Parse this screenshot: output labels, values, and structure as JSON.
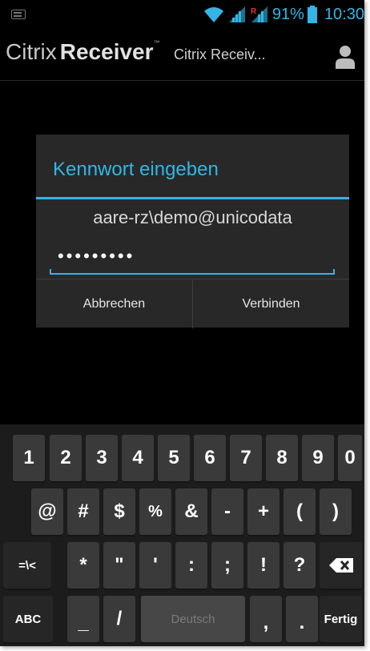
{
  "status_bar": {
    "battery": "91%",
    "clock": "10:30",
    "accent_color": "#33b5e5",
    "icons": [
      "keyboard-notification-icon",
      "wifi-icon",
      "signal-icon",
      "signal-roaming-icon",
      "battery-icon"
    ]
  },
  "action_bar": {
    "brand_citrix": "Citrix",
    "brand_receiver": "Receiver",
    "brand_tm": "™",
    "title": "Citrix Receiv...",
    "icons": [
      "user-icon"
    ]
  },
  "dialog": {
    "title": "Kennwort eingeben",
    "username": "aare-rz\\demo@unicodata",
    "password_masked": "•••••••••",
    "cancel_label": "Abbrechen",
    "connect_label": "Verbinden"
  },
  "keyboard": {
    "row1": [
      "1",
      "2",
      "3",
      "4",
      "5",
      "6",
      "7",
      "8",
      "9",
      "0"
    ],
    "row2": [
      "@",
      "#",
      "$",
      "%",
      "&",
      "-",
      "+",
      "(",
      ")"
    ],
    "row3": [
      "=\\<",
      "*",
      "\"",
      "'",
      ":",
      ";",
      "!",
      "?"
    ],
    "row4": {
      "abc": "ABC",
      "underscore": "_",
      "slash": "/",
      "space": "Deutsch",
      "comma": ",",
      "period": ".",
      "done": "Fertig"
    },
    "icons": [
      "backspace-icon"
    ]
  }
}
